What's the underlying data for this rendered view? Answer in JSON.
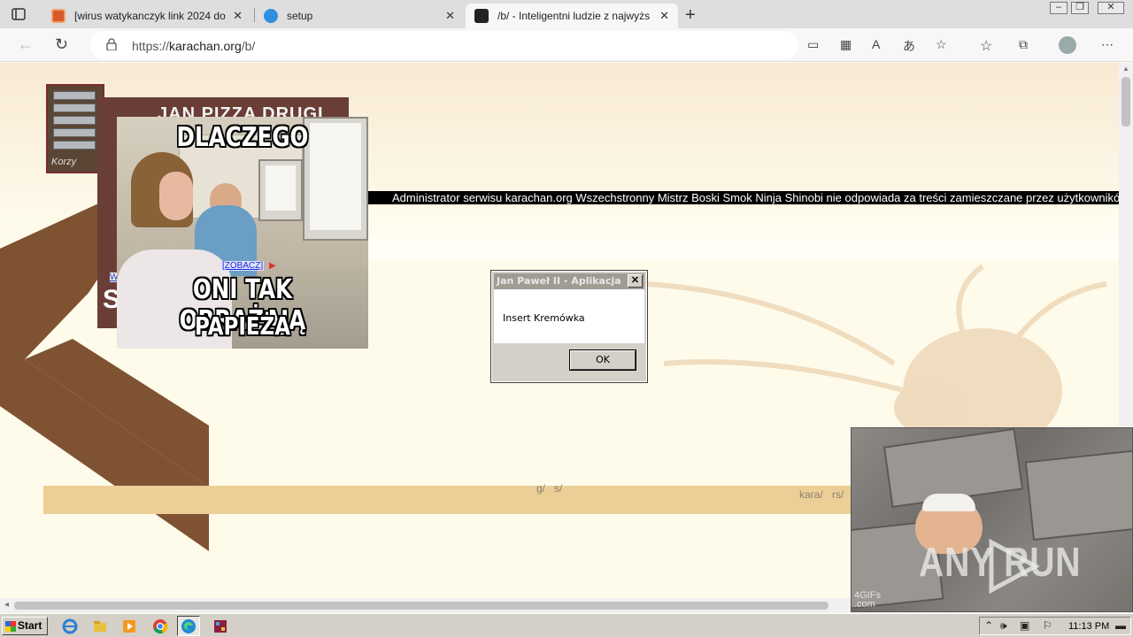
{
  "browser": {
    "tabs": [
      {
        "title": "[wirus watykanczyk link 2024 do",
        "icon": "archive-favicon"
      },
      {
        "title": "setup",
        "icon": "edge-blue-favicon"
      },
      {
        "title": "/b/ - Inteligentni ludzie z najwyżs",
        "icon": "karachan-favicon",
        "active": true
      }
    ],
    "url_prefix": "https://",
    "url_host": "karachan.org",
    "url_path": "/b/"
  },
  "page": {
    "marquee": "Administrator serwisu karachan.org Wszechstronny Mistrz Boski Smok Ninja Shinobi nie odpowiada za treści zamieszczane przez użytkowników;",
    "small_thumb_caption": "Korzy",
    "meme_back": {
      "headline": "JAN PIZZA DRUGI",
      "side_letter": "S",
      "link": "W"
    },
    "meme_front": {
      "top": "DLACZEGO",
      "line1": "ONI TAK OBRAŻAJĄ",
      "line2": "PAPIEŻA",
      "link": "[ZOBACZ]"
    },
    "board_links": [
      "g/",
      "s/",
      "kara/",
      "rs/"
    ]
  },
  "dialog": {
    "title": "Jan Paweł II - Aplikacja",
    "message": "Insert Kremówka",
    "ok_label": "OK",
    "close_glyph": "✕"
  },
  "overlay": {
    "watermark": "ANY RUN",
    "gif_brand": "4GIFs\n.com"
  },
  "taskbar": {
    "start_label": "Start",
    "clock": "11:13 PM"
  }
}
